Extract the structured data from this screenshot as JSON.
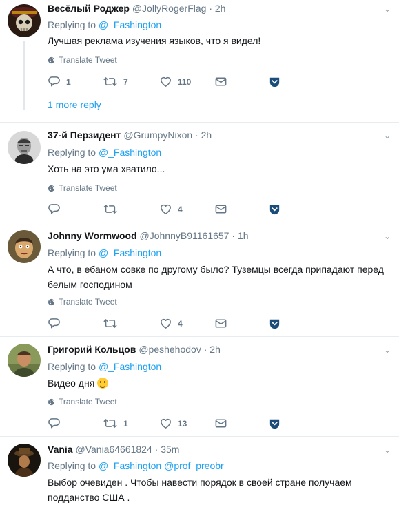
{
  "translate_label": "Translate Tweet",
  "replying_prefix": "Replying to",
  "tweets": [
    {
      "name": "Весёлый Роджер",
      "handle": "@JollyRogerFlag",
      "time": "2h",
      "replying_to": "@_Fashington",
      "text": "Лучшая реклама изучения языков, что я видел!",
      "replies": "1",
      "retweets": "7",
      "likes": "110",
      "more_replies": "1 more reply"
    },
    {
      "name": "37-й Перзидент",
      "handle": "@GrumpyNixon",
      "time": "2h",
      "replying_to": "@_Fashington",
      "text": "Хоть на это ума хватило...",
      "replies": "",
      "retweets": "",
      "likes": "4"
    },
    {
      "name": "Johnny Wormwood",
      "handle": "@JohnnyB91161657",
      "time": "1h",
      "replying_to": "@_Fashington",
      "text": "А что, в ебаном совке по другому было? Туземцы всегда припадают перед белым господином",
      "replies": "",
      "retweets": "",
      "likes": "4"
    },
    {
      "name": "Григорий Кольцов",
      "handle": "@peshehodov",
      "time": "2h",
      "replying_to": "@_Fashington",
      "text": "Видео дня",
      "replies": "",
      "retweets": "1",
      "likes": "13"
    },
    {
      "name": "Vania",
      "handle": "@Vania64661824",
      "time": "35m",
      "replying_to": "@_Fashington",
      "replying_to_2": "@prof_preobr",
      "text": "Выбор  очевиден . Чтобы навести порядок в своей стране получаем подданство США ."
    }
  ],
  "colors": {
    "link": "#1da1f2",
    "muted": "#657786",
    "border": "#e6ecf0",
    "dm": "#1b4d7a"
  },
  "icons": [
    "reply-icon",
    "retweet-icon",
    "like-icon",
    "dm-icon",
    "share-icon",
    "globe-icon",
    "chevron-down-icon"
  ]
}
